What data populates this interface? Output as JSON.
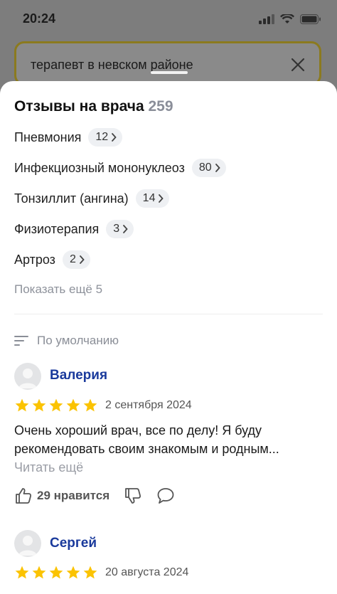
{
  "status": {
    "time": "20:24"
  },
  "search": {
    "query": "терапевт в невском районе"
  },
  "reviews": {
    "title": "Отзывы на врача",
    "count": "259",
    "topics": [
      {
        "label": "Пневмония",
        "count": "12"
      },
      {
        "label": "Инфекциозный мононуклеоз",
        "count": "80"
      },
      {
        "label": "Тонзиллит (ангина)",
        "count": "14"
      },
      {
        "label": "Физиотерапия",
        "count": "3"
      },
      {
        "label": "Артроз",
        "count": "2"
      }
    ],
    "show_more": "Показать ещё 5",
    "sort_label": "По умолчанию"
  },
  "review_list": [
    {
      "author": "Валерия",
      "rating": 5,
      "date": "2 сентября 2024",
      "text": "Очень хороший врач, все по делу! Я буду рекомендовать своим знакомым и родным...",
      "read_more": "Читать ещё",
      "likes": "29 нравится"
    },
    {
      "author": "Сергей",
      "rating": 5,
      "date": "20 августа 2024"
    }
  ],
  "colors": {
    "star": "#fbc302",
    "author": "#1a3a9c",
    "muted": "#8e929b"
  }
}
